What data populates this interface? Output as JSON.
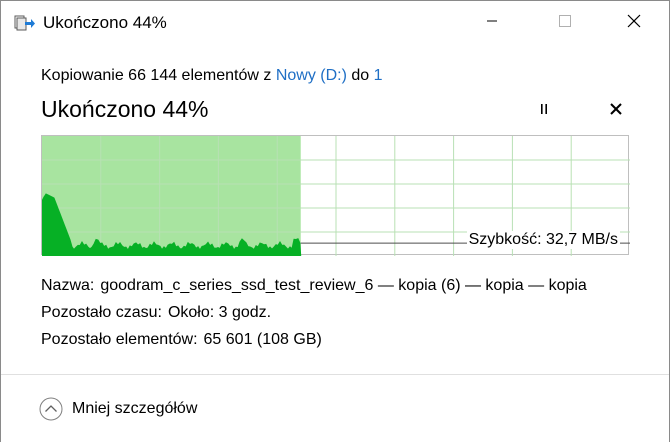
{
  "window": {
    "title": "Ukończono 44%",
    "icons": {
      "app": "copy-arrow-icon",
      "minimize": "minimize-icon",
      "maximize": "maximize-icon",
      "close": "close-icon"
    }
  },
  "copy": {
    "prefix": "Kopiowanie 66 144 elementów z",
    "source_link": "Nowy (D:)",
    "middle": "do",
    "destination_link": "1"
  },
  "progress": {
    "heading": "Ukończono 44%",
    "percent": 44,
    "pause_icon": "pause-icon",
    "cancel_icon": "cancel-icon"
  },
  "speed_graph": {
    "speed_label": "Szybkość: 32,7 MB/s",
    "fill_color": "#a8e4a0",
    "line_color": "#06b025",
    "grid_color": "#b8e0b4"
  },
  "details": {
    "name_label": "Nazwa:",
    "name_value": "goodram_c_series_ssd_test_review_6 — kopia (6) — kopia — kopia",
    "time_label": "Pozostało czasu:",
    "time_value": "Około: 3 godz.",
    "items_label": "Pozostało elementów:",
    "items_value": "65 601 (108 GB)"
  },
  "footer": {
    "less_details_label": "Mniej szczegółów",
    "chevron_icon": "chevron-up-circle-icon"
  }
}
